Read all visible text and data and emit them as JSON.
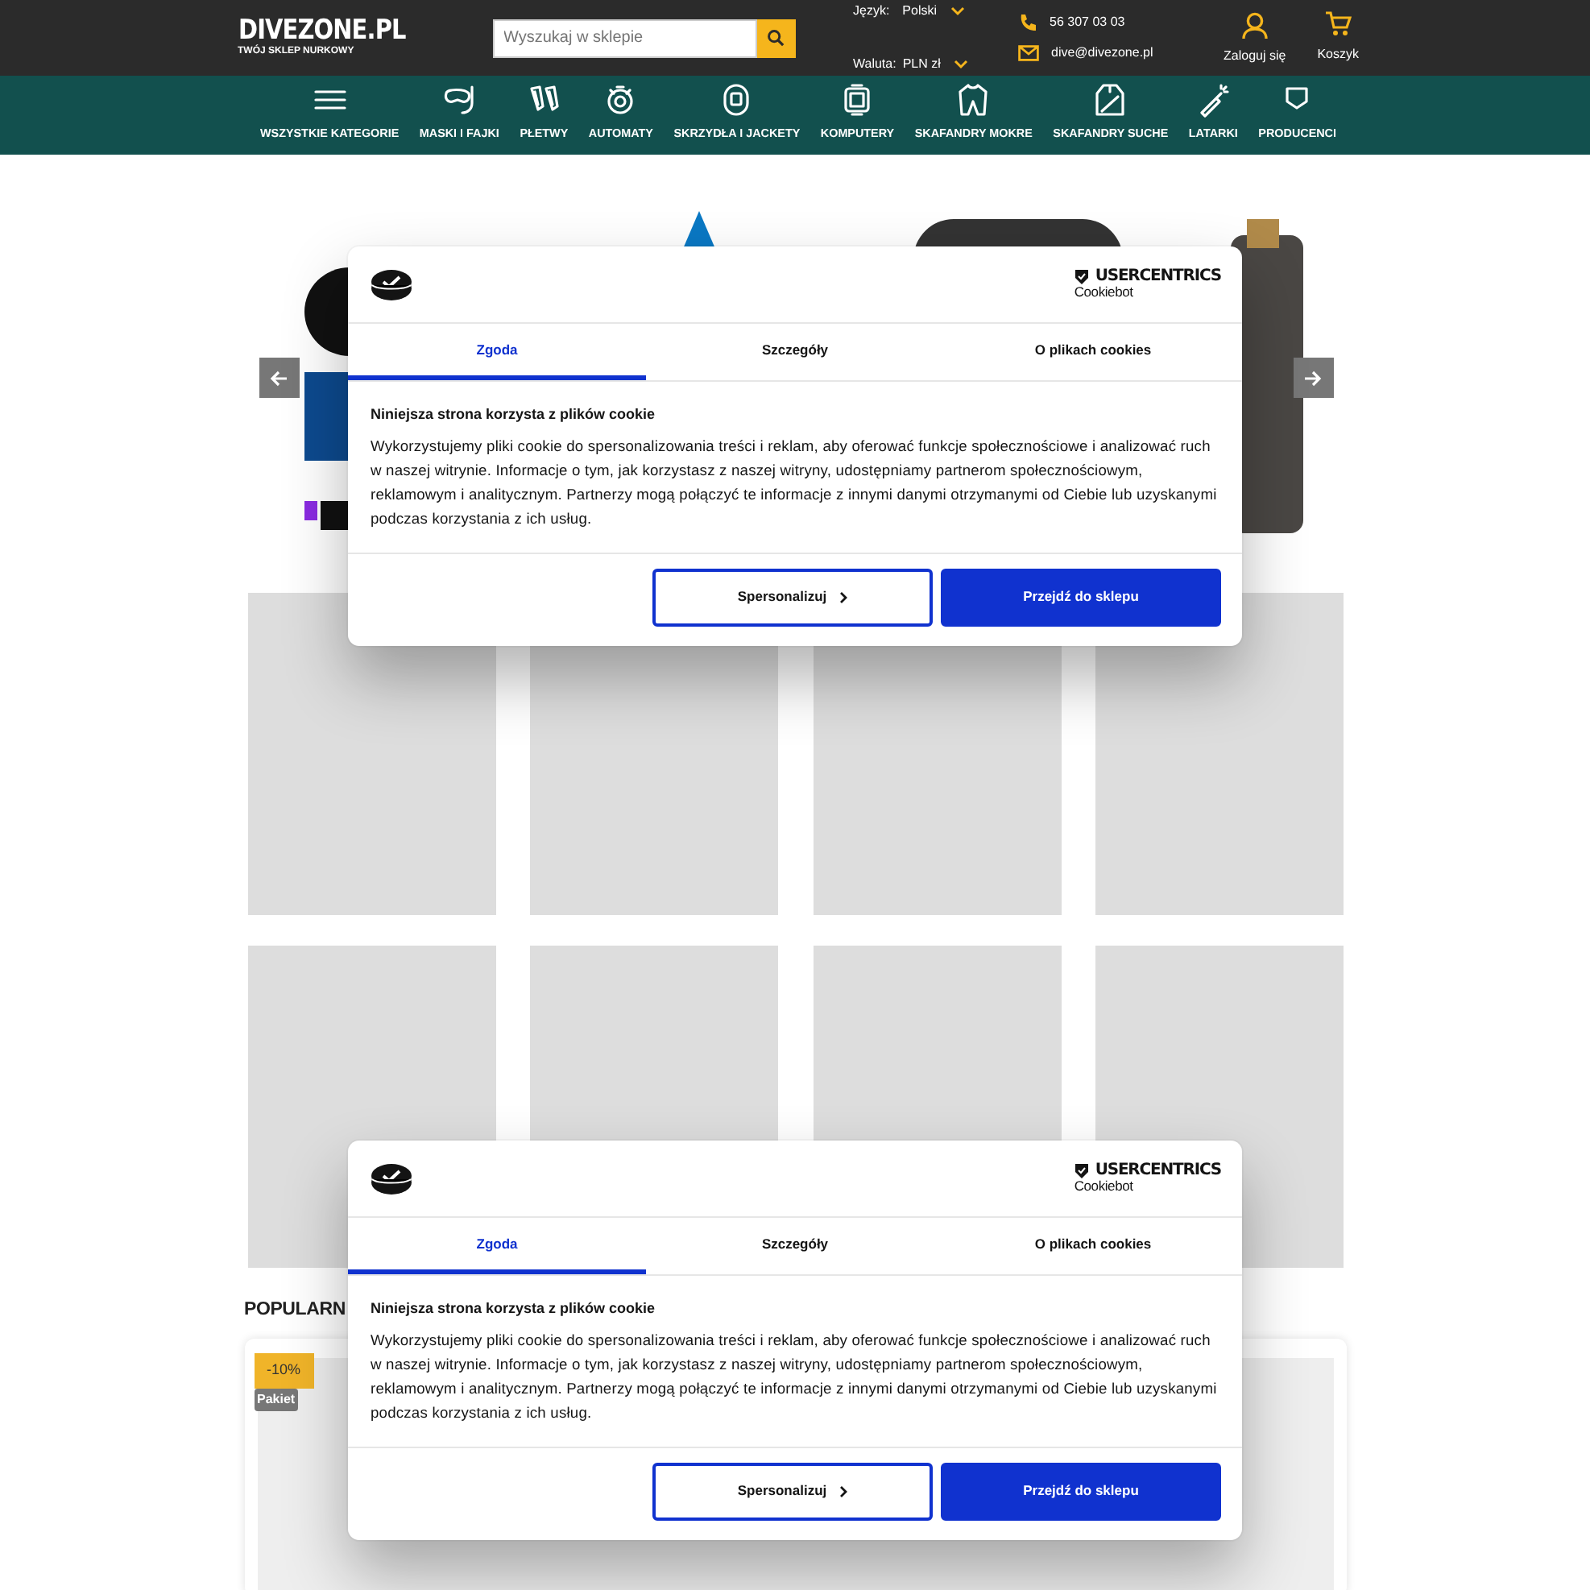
{
  "header": {
    "logo": {
      "title": "DIVEZONE.PL",
      "subtitle": "TWÓJ SKLEP NURKOWY"
    },
    "search": {
      "placeholder": "Wyszukaj w sklepie"
    },
    "language": {
      "label": "Język:",
      "value": "Polski"
    },
    "currency": {
      "label": "Waluta:",
      "value": "PLN zł"
    },
    "phone": "56 307 03 03",
    "email": "dive@divezone.pl",
    "account": "Zaloguj się",
    "cart": "Koszyk"
  },
  "nav": [
    {
      "label": "WSZYSTKIE KATEGORIE"
    },
    {
      "label": "MASKI I FAJKI"
    },
    {
      "label": "PŁETWY"
    },
    {
      "label": "AUTOMATY"
    },
    {
      "label": "SKRZYDŁA I JACKETY"
    },
    {
      "label": "KOMPUTERY"
    },
    {
      "label": "SKAFANDRY MOKRE"
    },
    {
      "label": "SKAFANDRY SUCHE"
    },
    {
      "label": "LATARKI"
    },
    {
      "label": "PRODUCENCI"
    }
  ],
  "popular": {
    "heading": "POPULARN",
    "badges": [
      {
        "text": "-10%",
        "kind": "discount"
      },
      {
        "text": "Pakiet",
        "kind": "tag"
      }
    ]
  },
  "cookie_dialogs": [
    {
      "brand": {
        "name": "USERCENTRICS",
        "sub": "Cookiebot"
      },
      "tabs": [
        {
          "label": "Zgoda",
          "selected": true
        },
        {
          "label": "Szczegóły",
          "selected": false
        },
        {
          "label": "O plikach cookies",
          "selected": false
        }
      ],
      "title": "Niniejsza strona korzysta z plików cookie",
      "body": "Wykorzystujemy pliki cookie do spersonalizowania treści i reklam, aby oferować funkcje społecznościowe i analizować ruch w naszej witrynie. Informacje o tym, jak korzystasz z naszej witryny, udostępniamy partnerom społecznościowym, reklamowym i analitycznym. Partnerzy mogą połączyć te informacje z innymi danymi otrzymanymi od Ciebie lub uzyskanymi podczas korzystania z ich usług.",
      "buttons": [
        {
          "label": "Spersonalizuj",
          "kind": "outline"
        },
        {
          "label": "Przejdź do sklepu",
          "kind": "primary"
        }
      ]
    },
    {
      "brand": {
        "name": "USERCENTRICS",
        "sub": "Cookiebot"
      },
      "tabs": [
        {
          "label": "Zgoda",
          "selected": true
        },
        {
          "label": "Szczegóły",
          "selected": false
        },
        {
          "label": "O plikach cookies",
          "selected": false
        }
      ],
      "title": "Niniejsza strona korzysta z plików cookie",
      "body": "Wykorzystujemy pliki cookie do spersonalizowania treści i reklam, aby oferować funkcje społecznościowe i analizować ruch w naszej witrynie. Informacje o tym, jak korzystasz z naszej witryny, udostępniamy partnerom społecznościowym, reklamowym i analitycznym. Partnerzy mogą połączyć te informacje z innymi danymi otrzymanymi od Ciebie lub uzyskanymi podczas korzystania z ich usług.",
      "buttons": [
        {
          "label": "Spersonalizuj",
          "kind": "outline"
        },
        {
          "label": "Przejdź do sklepu",
          "kind": "primary"
        }
      ]
    }
  ]
}
